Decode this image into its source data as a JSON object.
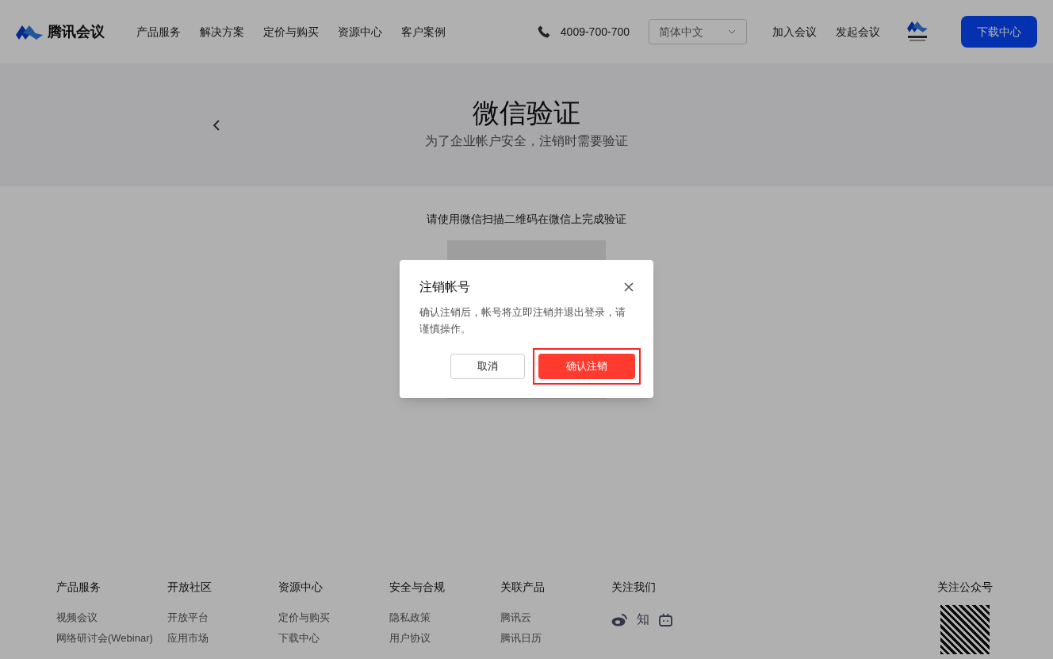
{
  "header": {
    "brand": "腾讯会议",
    "nav": [
      "产品服务",
      "解决方案",
      "定价与购买",
      "资源中心",
      "客户案例"
    ],
    "phone": "4009-700-700",
    "language": "简体中文",
    "links": [
      "加入会议",
      "发起会议"
    ],
    "download": "下载中心"
  },
  "hero": {
    "title": "微信验证",
    "subtitle": "为了企业帐户安全，注销时需要验证"
  },
  "verify": {
    "instruction": "请使用微信扫描二维码在微信上完成验证"
  },
  "dialog": {
    "title": "注销帐号",
    "message": "确认注销后，帐号将立即注销并退出登录，请谨慎操作。",
    "cancel": "取消",
    "confirm": "确认注销",
    "confirm_highlighted": true
  },
  "footer": {
    "columns": [
      {
        "title": "产品服务",
        "links": [
          "视频会议",
          "网络研讨会(Webinar)"
        ]
      },
      {
        "title": "开放社区",
        "links": [
          "开放平台",
          "应用市场"
        ]
      },
      {
        "title": "资源中心",
        "links": [
          "定价与购买",
          "下载中心"
        ]
      },
      {
        "title": "安全与合规",
        "links": [
          "隐私政策",
          "用户协议"
        ]
      },
      {
        "title": "关联产品",
        "links": [
          "腾讯云",
          "腾讯日历"
        ]
      }
    ],
    "follow": {
      "title": "关注我们",
      "zhihu": "知"
    },
    "official": {
      "title": "关注公众号"
    }
  }
}
